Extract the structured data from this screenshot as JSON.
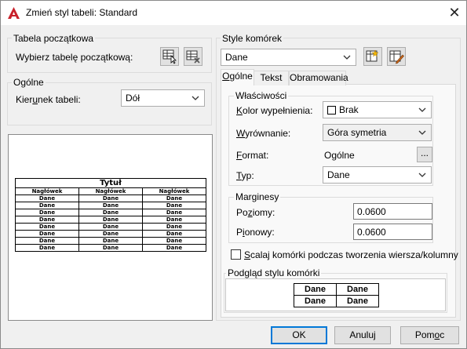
{
  "title": "Zmień styl tabeli: Standard",
  "tabela_poczatkowa": {
    "group_label": "Tabela początkowa",
    "prompt": "Wybierz tabelę początkową:"
  },
  "ogolne": {
    "group_label": "Ogólne",
    "direction_label": "Kierunek tabeli:",
    "direction_value": "Dół"
  },
  "preview_table": {
    "title": "Tytuł",
    "headers": [
      "Nagłówek",
      "Nagłówek",
      "Nagłówek"
    ],
    "cell": "Dane",
    "row_count": 8
  },
  "cell_styles": {
    "group_label": "Style komórek",
    "selected": "Dane",
    "tabs": [
      "Ogólne",
      "Tekst",
      "Obramowania"
    ],
    "active_tab": "Ogólne"
  },
  "wlasciwosci": {
    "group_label": "Właściwości",
    "fill_label": "Kolor wypełnienia:",
    "fill_value": "Brak",
    "alignment_label": "Wyrównanie:",
    "alignment_value": "Góra symetria",
    "format_label": "Format:",
    "format_value": "Ogólne",
    "format_button": "...",
    "type_label": "Typ:",
    "type_value": "Dane"
  },
  "marginesy": {
    "group_label": "Marginesy",
    "horizontal_label": "Poziomy:",
    "horizontal_value": "0.0600",
    "vertical_label": "Pionowy:",
    "vertical_value": "0.0600"
  },
  "merge_checkbox": {
    "label": "Scalaj komórki podczas tworzenia wiersza/kolumny",
    "checked": false
  },
  "cell_preview": {
    "group_label": "Podgląd stylu komórki",
    "cells": [
      [
        "Dane",
        "Dane"
      ],
      [
        "Dane",
        "Dane"
      ]
    ]
  },
  "buttons": {
    "ok": "OK",
    "cancel": "Anuluj",
    "help": "Pomoc"
  },
  "colors": {
    "accent": "#0078d7",
    "app_icon": "#c8202a"
  },
  "icons": [
    "autocad-app-icon",
    "close-icon",
    "select-table-icon",
    "remove-table-icon",
    "create-cell-style-icon",
    "manage-cell-styles-icon",
    "dropdown-arrow-icon"
  ]
}
